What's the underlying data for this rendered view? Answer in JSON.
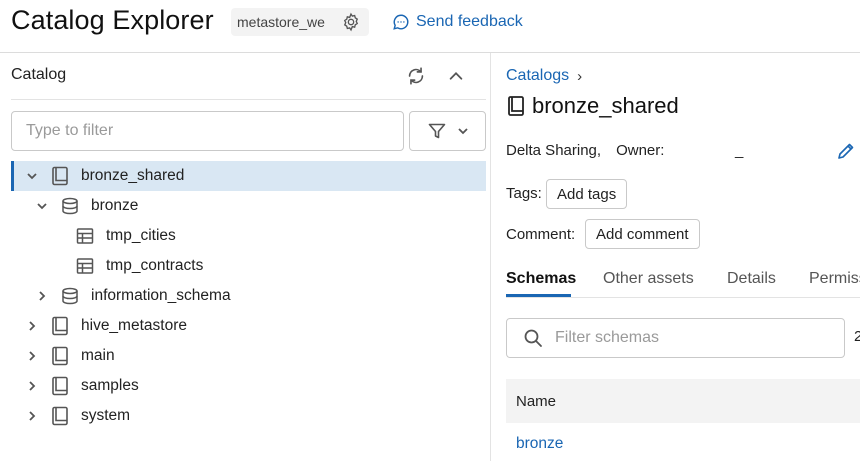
{
  "header": {
    "app_title": "Catalog Explorer",
    "metastore_label": "metastore_we",
    "feedback_label": "Send feedback"
  },
  "left_panel": {
    "title": "Catalog",
    "filter_placeholder": "Type to filter",
    "tree": [
      {
        "label": "bronze_shared",
        "type": "catalog",
        "level": 0,
        "expanded": true,
        "selected": true
      },
      {
        "label": "bronze",
        "type": "schema",
        "level": 1,
        "expanded": true
      },
      {
        "label": "tmp_cities",
        "type": "table",
        "level": 2
      },
      {
        "label": "tmp_contracts",
        "type": "table",
        "level": 2
      },
      {
        "label": "information_schema",
        "type": "schema",
        "level": 1,
        "expanded": false
      },
      {
        "label": "hive_metastore",
        "type": "catalog",
        "level": 0,
        "expanded": false
      },
      {
        "label": "main",
        "type": "catalog",
        "level": 0,
        "expanded": false
      },
      {
        "label": "samples",
        "type": "catalog",
        "level": 0,
        "expanded": false
      },
      {
        "label": "system",
        "type": "catalog",
        "level": 0,
        "expanded": false
      }
    ]
  },
  "detail": {
    "breadcrumb_root": "Catalogs",
    "breadcrumb_sep": "›",
    "catalog_name": "bronze_shared",
    "type_label": "Delta Sharing,",
    "owner_label": "Owner:",
    "owner_value": "_",
    "tags_label": "Tags:",
    "add_tags_label": "Add tags",
    "comment_label": "Comment:",
    "add_comment_label": "Add comment",
    "tabs": [
      {
        "label": "Schemas",
        "active": true
      },
      {
        "label": "Other assets",
        "active": false
      },
      {
        "label": "Details",
        "active": false
      },
      {
        "label": "Permiss",
        "active": false
      }
    ],
    "schema_filter_placeholder": "Filter schemas",
    "schema_count": "2",
    "table_header_name": "Name",
    "schemas": [
      "bronze"
    ]
  },
  "colors": {
    "accent": "#1a66b3",
    "selected_row_bg": "#d9e7f3"
  },
  "icons": {
    "settings": "gear-icon",
    "feedback": "chat-bubble-icon",
    "refresh": "refresh-icon",
    "collapse": "chevron-up-icon",
    "filter": "filter-icon",
    "catalog": "book-icon",
    "schema": "database-icon",
    "table": "table-icon",
    "edit": "pencil-icon",
    "search": "search-icon"
  }
}
